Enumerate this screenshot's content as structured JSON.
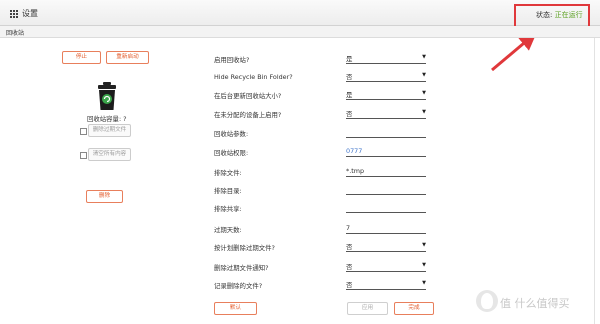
{
  "header": {
    "title": "设置",
    "status_label": "状态:",
    "status_value": "正在运行"
  },
  "subheader": {
    "title": "回收站"
  },
  "actions": {
    "stop": "停止",
    "restart": "重新启动",
    "delete": "删除"
  },
  "recycle": {
    "capacity_label": "回收站容量: ?",
    "clear_old_label": "删除过期文件",
    "clear_all_label": "清空所有内容"
  },
  "settings": {
    "enable": {
      "label": "启用回收站?",
      "value": "是"
    },
    "hide_folder": {
      "label": "Hide Recycle Bin Folder?",
      "value": "否"
    },
    "bg_update": {
      "label": "在后台更新回收站大小?",
      "value": "是"
    },
    "unassigned": {
      "label": "在未分配的设备上启用?",
      "value": "否"
    },
    "params": {
      "label": "回收站参数:",
      "value": ""
    },
    "permissions": {
      "label": "回收站权限:",
      "value": "0777"
    },
    "exclude_files": {
      "label": "排除文件:",
      "value": "*.tmp"
    },
    "exclude_dirs": {
      "label": "排除目录:",
      "value": ""
    },
    "exclude_shares": {
      "label": "排除共享:",
      "value": ""
    },
    "expire_days": {
      "label": "过期天数:",
      "value": "7"
    },
    "scheduled_delete": {
      "label": "按计划删除过期文件?",
      "value": "否"
    },
    "notify_delete": {
      "label": "删除过期文件通知?",
      "value": "否"
    },
    "log_deleted": {
      "label": "记录删除的文件?",
      "value": "否"
    }
  },
  "footer": {
    "default": "默认",
    "apply": "应用",
    "done": "完成"
  },
  "watermark": {
    "text": "值 什么值得买"
  },
  "colors": {
    "accent": "#e35a2a",
    "status": "#5aa020",
    "highlight": "#e0383b"
  }
}
